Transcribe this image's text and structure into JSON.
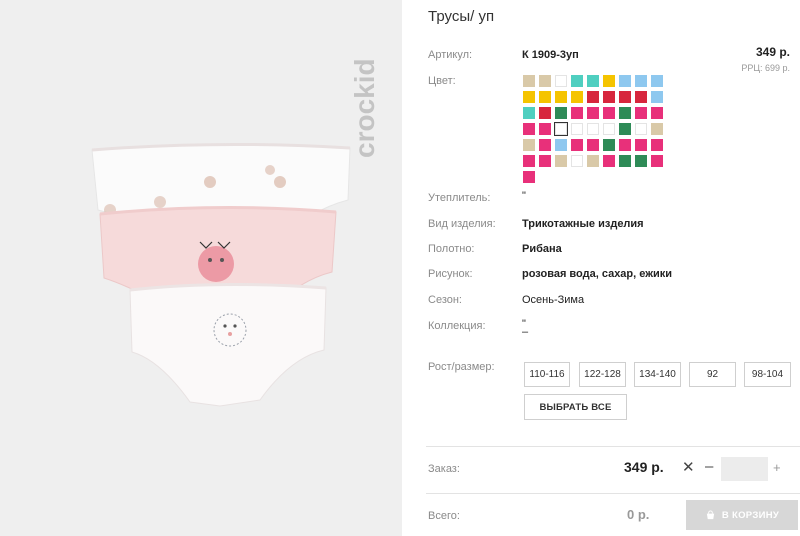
{
  "product": {
    "title": "Трусы/ уп",
    "brand_logo_text": "crockid"
  },
  "price": {
    "value": "349 р.",
    "rrc": "РРЦ: 699 р."
  },
  "specs": {
    "article_label": "Артикул:",
    "article_value": "К 1909-3уп",
    "color_label": "Цвет:",
    "insulation_label": "Утеплитель:",
    "insulation_value": "\"",
    "type_label": "Вид изделия:",
    "type_value": "Трикотажные изделия",
    "fabric_label": "Полотно:",
    "fabric_value": "Рибана",
    "pattern_label": "Рисунок:",
    "pattern_value": "розовая вода, сахар, ежики",
    "season_label": "Сезон:",
    "season_value": "Осень-Зима",
    "collection_label": "Коллекция:",
    "collection_value": "\"",
    "collection_value2": "–",
    "size_label": "Рост/размер:"
  },
  "swatch_rows": [
    [
      "#d9c9a8",
      "#d9c9a8",
      "#ffffff",
      "#4fcfc0",
      "#4fcfc0",
      "#f5c400",
      "#8ec8ef",
      "#8ec8ef",
      "#8ec8ef"
    ],
    [
      "#f5c400",
      "#f5c400",
      "#f5c400",
      "#f5c400",
      "#d7263d",
      "#d7263d",
      "#d7263d",
      "#d7263d",
      "#8ec8ef"
    ],
    [
      "#4fcfc0",
      "#d7263d",
      "#2e8b57",
      "#e8307a",
      "#e8307a",
      "#e8307a",
      "#2e8b57",
      "#e8307a",
      "#e8307a"
    ],
    [
      "#e8307a",
      "#e8307a",
      "#ffffff",
      "#ffffff",
      "#ffffff",
      "#ffffff",
      "#2e8b57",
      "#ffffff",
      "#d9c9a8"
    ],
    [
      "#d9c9a8",
      "#e8307a",
      "#8ec8ef",
      "#e8307a",
      "#e8307a",
      "#2e8b57",
      "#e8307a",
      "#e8307a",
      "#e8307a"
    ],
    [
      "#e8307a",
      "#e8307a",
      "#d9c9a8",
      "#ffffff",
      "#d9c9a8",
      "#e8307a",
      "#2e8b57",
      "#2e8b57",
      "#e8307a"
    ],
    [
      "#e8307a"
    ]
  ],
  "selected_swatch": "3-2",
  "sizes": [
    "110-116",
    "122-128",
    "134-140",
    "92",
    "98-104"
  ],
  "select_all_label": "ВЫБРАТЬ ВСЕ",
  "order": {
    "label": "Заказ:",
    "price": "349 р.",
    "times": "✕",
    "minus": "–",
    "quantity": "",
    "plus": "+"
  },
  "total": {
    "label": "Всего:",
    "price": "0 р.",
    "cart_label": "В КОРЗИНУ"
  },
  "icons": {
    "cart": "cart-icon"
  }
}
